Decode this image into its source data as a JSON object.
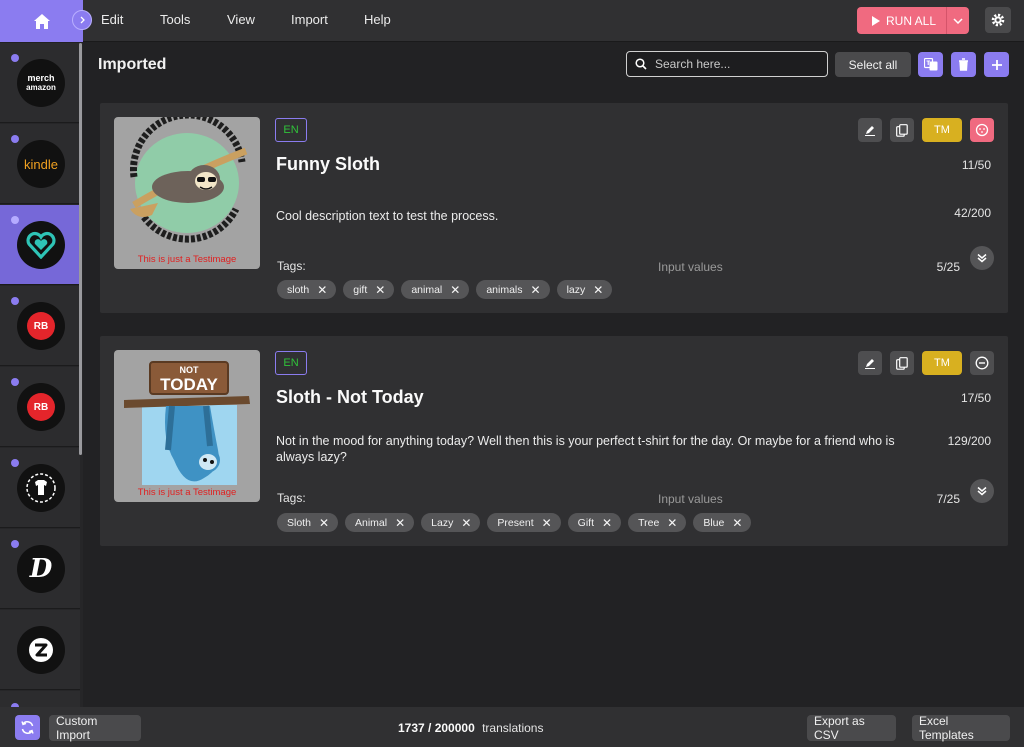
{
  "menu": {
    "edit": "Edit",
    "tools": "Tools",
    "view": "View",
    "import": "Import",
    "help": "Help"
  },
  "toolbar": {
    "run_all": "RUN ALL"
  },
  "sidebar": {
    "items": [
      {
        "name": "merch",
        "logo_line1": "merch",
        "logo_line2": "amazon",
        "active": false
      },
      {
        "name": "kindle",
        "logo_text": "kindle",
        "active": false
      },
      {
        "name": "heart-platform",
        "active": true
      },
      {
        "name": "redbubble-1",
        "logo_text": "RB",
        "active": false
      },
      {
        "name": "redbubble-2",
        "logo_text": "RB",
        "active": false
      },
      {
        "name": "shirt-platform",
        "active": false
      },
      {
        "name": "d-platform",
        "logo_text": "D",
        "active": false
      },
      {
        "name": "z-platform",
        "active": false
      }
    ]
  },
  "header": {
    "title": "Imported",
    "search_placeholder": "Search here...",
    "select_all": "Select all"
  },
  "cards": [
    {
      "lang": "EN",
      "title": "Funny Sloth",
      "title_count": "11/50",
      "description": "Cool description text to test the process.",
      "desc_count": "42/200",
      "tags_label": "Tags:",
      "input_values": "Input values",
      "tags_count": "5/25",
      "tags": [
        "sloth",
        "gift",
        "animal",
        "animals",
        "lazy"
      ],
      "tm": "TM",
      "image_caption": "This is just a Testimage",
      "status_color": "#f06a80"
    },
    {
      "lang": "EN",
      "title": "Sloth - Not Today",
      "title_count": "17/50",
      "description": "Not in the mood for anything today? Well then this is your perfect t-shirt for the day. Or maybe for a friend who is always lazy?",
      "desc_count": "129/200",
      "tags_label": "Tags:",
      "input_values": "Input values",
      "tags_count": "7/25",
      "tags": [
        "Sloth",
        "Animal",
        "Lazy",
        "Present",
        "Gift",
        "Tree",
        "Blue"
      ],
      "tm": "TM",
      "image_caption": "This is just a Testimage",
      "image_text_top": "NOT",
      "image_text_main": "TODAY",
      "status_color": "#4e4e50"
    }
  ],
  "footer": {
    "custom_import": "Custom Import",
    "translations_used": "1737 / 200000",
    "translations_label": "translations",
    "export_csv": "Export as CSV",
    "excel_templates": "Excel Templates"
  },
  "colors": {
    "accent": "#8b7cf0",
    "run_all": "#f06a80",
    "tm": "#d8b020",
    "lang_text": "#30c23a"
  }
}
